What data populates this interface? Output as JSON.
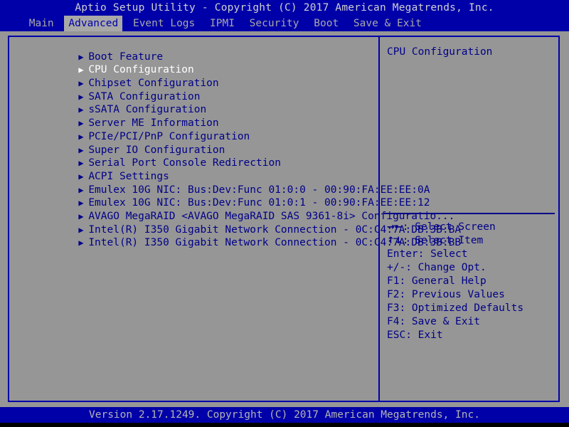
{
  "title": "Aptio Setup Utility - Copyright (C) 2017 American Megatrends, Inc.",
  "menu": {
    "items": [
      {
        "label": "Main",
        "active": false
      },
      {
        "label": "Advanced",
        "active": true
      },
      {
        "label": "Event Logs",
        "active": false
      },
      {
        "label": "IPMI",
        "active": false
      },
      {
        "label": "Security",
        "active": false
      },
      {
        "label": "Boot",
        "active": false
      },
      {
        "label": "Save & Exit",
        "active": false
      }
    ]
  },
  "list": {
    "arrow_glyph": "▶",
    "items": [
      {
        "label": "Boot Feature",
        "selected": false
      },
      {
        "label": "CPU Configuration",
        "selected": true
      },
      {
        "label": "Chipset Configuration",
        "selected": false
      },
      {
        "label": "SATA Configuration",
        "selected": false
      },
      {
        "label": "sSATA Configuration",
        "selected": false
      },
      {
        "label": "Server ME Information",
        "selected": false
      },
      {
        "label": "PCIe/PCI/PnP Configuration",
        "selected": false
      },
      {
        "label": "Super IO Configuration",
        "selected": false
      },
      {
        "label": "Serial Port Console Redirection",
        "selected": false
      },
      {
        "label": "ACPI Settings",
        "selected": false
      },
      {
        "label": "Emulex 10G NIC: Bus:Dev:Func 01:0:0 - 00:90:FA:EE:EE:0A",
        "selected": false
      },
      {
        "label": "Emulex 10G NIC: Bus:Dev:Func 01:0:1 - 00:90:FA:EE:EE:12",
        "selected": false
      },
      {
        "label": "AVAGO MegaRAID <AVAGO MegaRAID SAS 9361-8i> Configuratio...",
        "selected": false
      },
      {
        "label": "Intel(R) I350 Gigabit Network Connection - 0C:C4:7A:DB:3B:BA",
        "selected": false
      },
      {
        "label": "Intel(R) I350 Gigabit Network Connection - 0C:C4:7A:DB:3B:BB",
        "selected": false
      }
    ]
  },
  "help": {
    "description": "CPU Configuration",
    "keys": [
      {
        "glyph": "→←",
        "text": ": Select Screen"
      },
      {
        "glyph": "↑↓",
        "text": ": Select Item"
      },
      {
        "glyph": "",
        "text": "Enter: Select"
      },
      {
        "glyph": "",
        "text": "+/-: Change Opt."
      },
      {
        "glyph": "",
        "text": "F1: General Help"
      },
      {
        "glyph": "",
        "text": "F2: Previous Values"
      },
      {
        "glyph": "",
        "text": "F3: Optimized Defaults"
      },
      {
        "glyph": "",
        "text": "F4: Save & Exit"
      },
      {
        "glyph": "",
        "text": "ESC: Exit"
      }
    ]
  },
  "footer": "Version 2.17.1249. Copyright (C) 2017 American Megatrends, Inc.",
  "colors": {
    "header_blue": "#0000a8",
    "body_gray": "#969696",
    "text_blue": "#000088",
    "selected_white": "#ffffff",
    "title_text": "#d0d0d0",
    "menu_text": "#a8a8a8"
  }
}
